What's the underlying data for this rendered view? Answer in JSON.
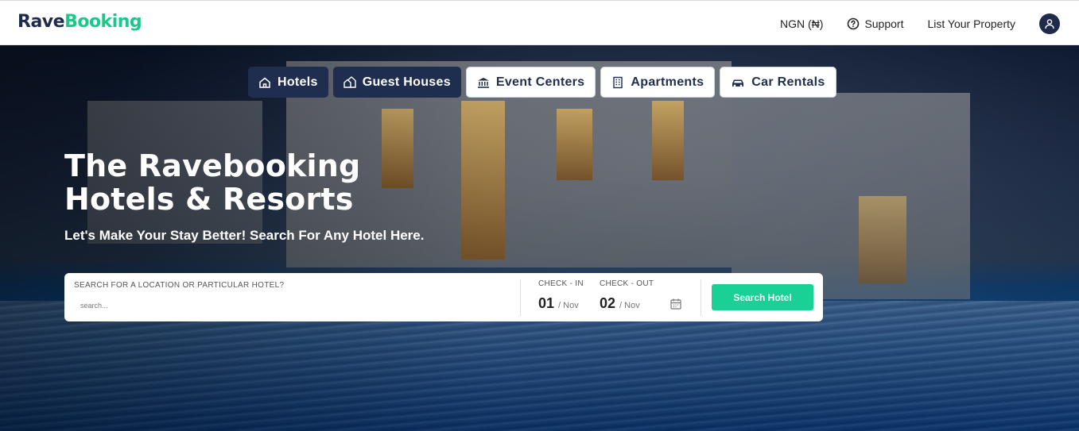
{
  "brand": {
    "part1": "Rave",
    "part2": "Booking",
    "color_dark": "#1f2a4d",
    "color_accent": "#19c98a"
  },
  "nav": {
    "currency": "NGN (₦)",
    "support": "Support",
    "list_property": "List Your Property"
  },
  "tabs": [
    {
      "label": "Hotels",
      "icon": "home-icon",
      "active": true
    },
    {
      "label": "Guest Houses",
      "icon": "houses-icon",
      "active": true
    },
    {
      "label": "Event Centers",
      "icon": "bank-icon",
      "active": false
    },
    {
      "label": "Apartments",
      "icon": "building-icon",
      "active": false
    },
    {
      "label": "Car Rentals",
      "icon": "car-icon",
      "active": false
    }
  ],
  "hero": {
    "title_line1": "The Ravebooking",
    "title_line2": "Hotels & Resorts",
    "subtitle": "Let's Make Your Stay Better! Search For Any Hotel Here."
  },
  "search": {
    "label": "SEARCH FOR A LOCATION OR PARTICULAR HOTEL?",
    "placeholder": "search...",
    "checkin_label": "CHECK - IN",
    "checkin_day": "01",
    "checkin_month": "/ Nov",
    "checkout_label": "CHECK - OUT",
    "checkout_day": "02",
    "checkout_month": "/ Nov",
    "button": "Search Hotel",
    "button_color": "#19d195"
  }
}
